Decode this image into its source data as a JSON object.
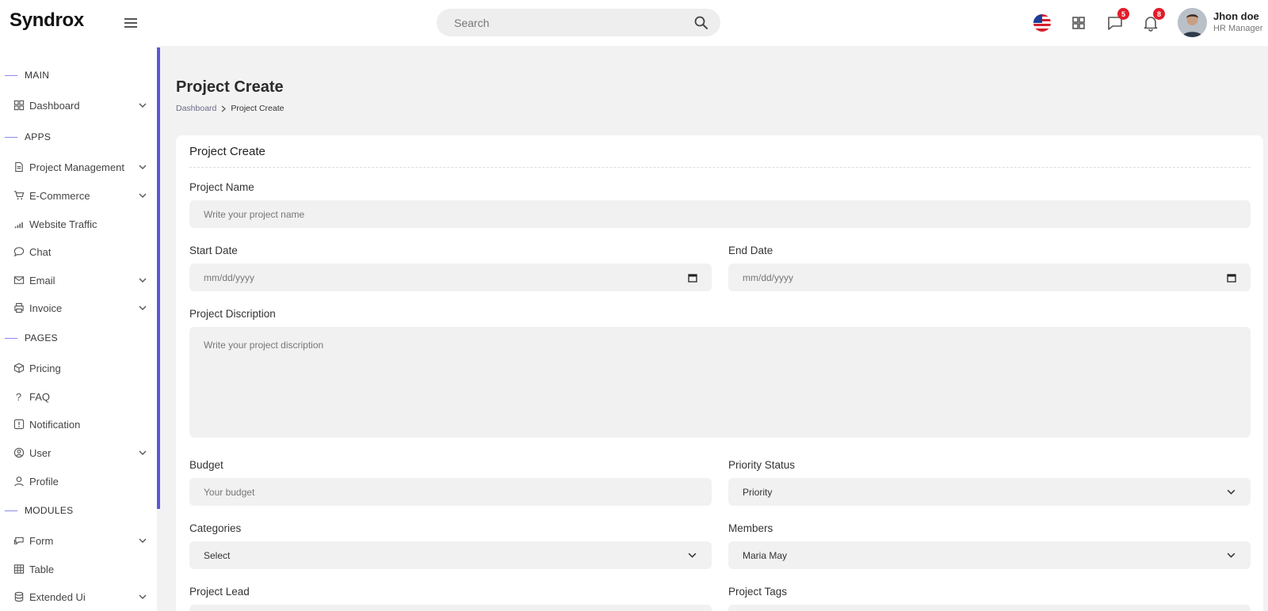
{
  "header": {
    "logo": "Syndrox",
    "search_placeholder": "Search",
    "messages_badge": "5",
    "notifications_badge": "8",
    "user_name": "Jhon doe",
    "user_role": "HR Manager"
  },
  "sidebar": {
    "sections": [
      "MAIN",
      "APPS",
      "PAGES",
      "MODULES"
    ],
    "items": [
      {
        "label": "Dashboard",
        "icon": "grid-icon",
        "has_children": true
      },
      {
        "label": "Project Management",
        "icon": "document-icon",
        "has_children": true
      },
      {
        "label": "E-Commerce",
        "icon": "cart-icon",
        "has_children": true
      },
      {
        "label": "Website Traffic",
        "icon": "signal-icon",
        "has_children": false
      },
      {
        "label": "Chat",
        "icon": "chat-icon",
        "has_children": false
      },
      {
        "label": "Email",
        "icon": "mail-icon",
        "has_children": true
      },
      {
        "label": "Invoice",
        "icon": "printer-icon",
        "has_children": true
      },
      {
        "label": "Pricing",
        "icon": "box-icon",
        "has_children": false
      },
      {
        "label": "FAQ",
        "icon": "question-icon",
        "has_children": false
      },
      {
        "label": "Notification",
        "icon": "alert-icon",
        "has_children": false
      },
      {
        "label": "User",
        "icon": "user-circle-icon",
        "has_children": true
      },
      {
        "label": "Profile",
        "icon": "person-icon",
        "has_children": false
      },
      {
        "label": "Form",
        "icon": "form-icon",
        "has_children": true
      },
      {
        "label": "Table",
        "icon": "table-icon",
        "has_children": false
      },
      {
        "label": "Extended Ui",
        "icon": "database-icon",
        "has_children": true
      }
    ],
    "accent_color": "#5b57d6"
  },
  "page": {
    "title": "Project Create",
    "breadcrumb": [
      "Dashboard",
      "Project Create"
    ]
  },
  "form": {
    "card_title": "Project Create",
    "project_name_label": "Project Name",
    "project_name_placeholder": "Write your project name",
    "start_date_label": "Start Date",
    "start_date_placeholder": "mm/dd/yyyy",
    "end_date_label": "End Date",
    "end_date_placeholder": "mm/dd/yyyy",
    "description_label": "Project Discription",
    "description_placeholder": "Write your project discription",
    "budget_label": "Budget",
    "budget_placeholder": "Your budget",
    "priority_label": "Priority Status",
    "priority_value": "Priority",
    "categories_label": "Categories",
    "categories_value": "Select",
    "members_label": "Members",
    "members_value": "Maria May",
    "lead_label": "Project Lead",
    "tags_label": "Project Tags"
  }
}
